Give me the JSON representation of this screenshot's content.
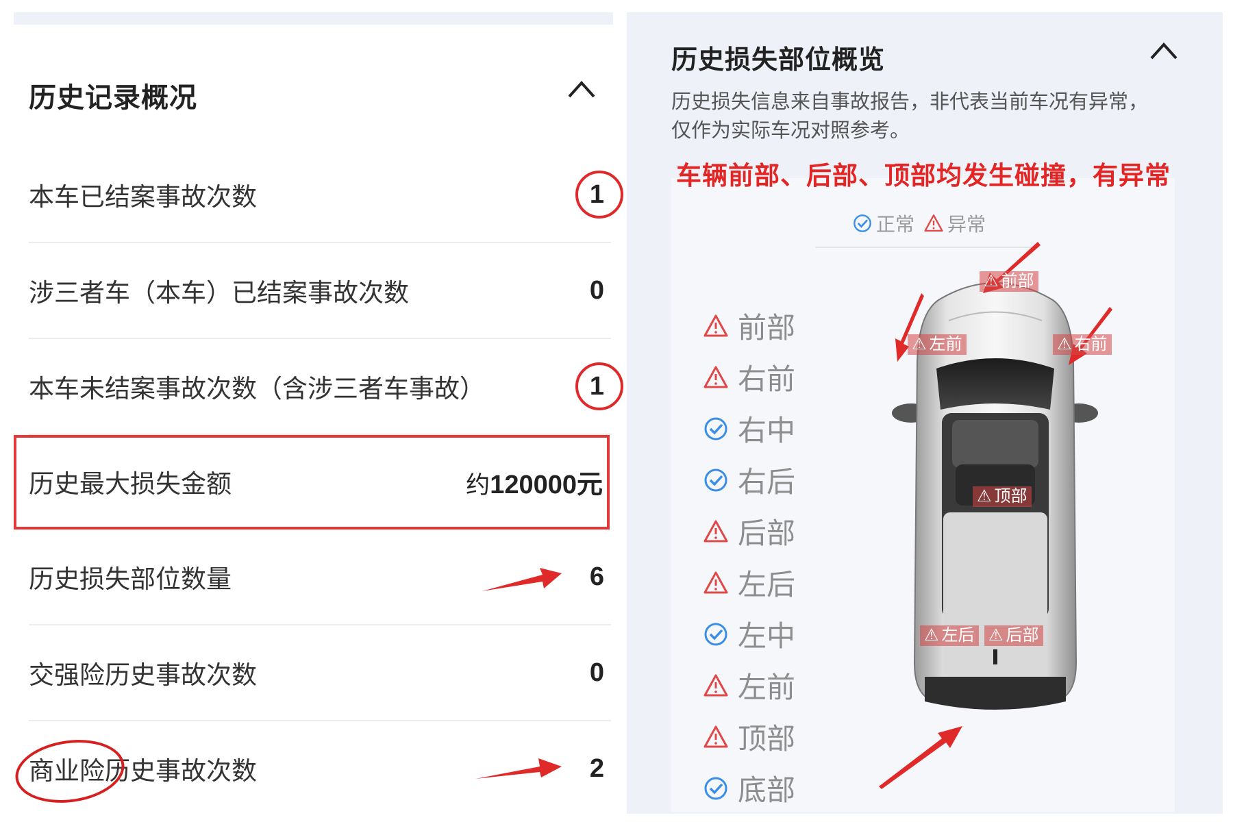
{
  "history": {
    "title": "历史记录概况",
    "rows": [
      {
        "label": "本车已结案事故次数",
        "value": "1"
      },
      {
        "label": "涉三者车（本车）已结案事故次数",
        "value": "0"
      },
      {
        "label": "本车未结案事故次数（含涉三者车事故）",
        "value": "1"
      },
      {
        "label": "历史最大损失金额",
        "value_prefix": "约",
        "value": "120000元"
      },
      {
        "label": "历史损失部位数量",
        "value": "6"
      },
      {
        "label": "交强险历史事故次数",
        "value": "0"
      },
      {
        "label": "商业险历史事故次数",
        "value": "2"
      }
    ]
  },
  "overview": {
    "title": "历史损失部位概览",
    "desc_line1": "历史损失信息来自事故报告，非代表当前车况有异常，",
    "desc_line2": "仅作为实际车况对照参考。",
    "annotation": "车辆前部、后部、顶部均发生碰撞，有异常",
    "legend": {
      "normal": "正常",
      "abnormal": "异常"
    },
    "parts": [
      {
        "label": "前部",
        "status": "abnormal"
      },
      {
        "label": "右前",
        "status": "abnormal"
      },
      {
        "label": "右中",
        "status": "normal"
      },
      {
        "label": "右后",
        "status": "normal"
      },
      {
        "label": "后部",
        "status": "abnormal"
      },
      {
        "label": "左后",
        "status": "abnormal"
      },
      {
        "label": "左中",
        "status": "normal"
      },
      {
        "label": "左前",
        "status": "abnormal"
      },
      {
        "label": "顶部",
        "status": "abnormal"
      },
      {
        "label": "底部",
        "status": "normal"
      }
    ],
    "car_tags": {
      "front": "前部",
      "left_front": "左前",
      "right_front": "右前",
      "top": "顶部",
      "left_rear": "左后",
      "rear": "后部"
    }
  },
  "colors": {
    "accent_red": "#e02a2a",
    "normal_blue": "#3a8ee6",
    "warn_red": "#e04848"
  }
}
